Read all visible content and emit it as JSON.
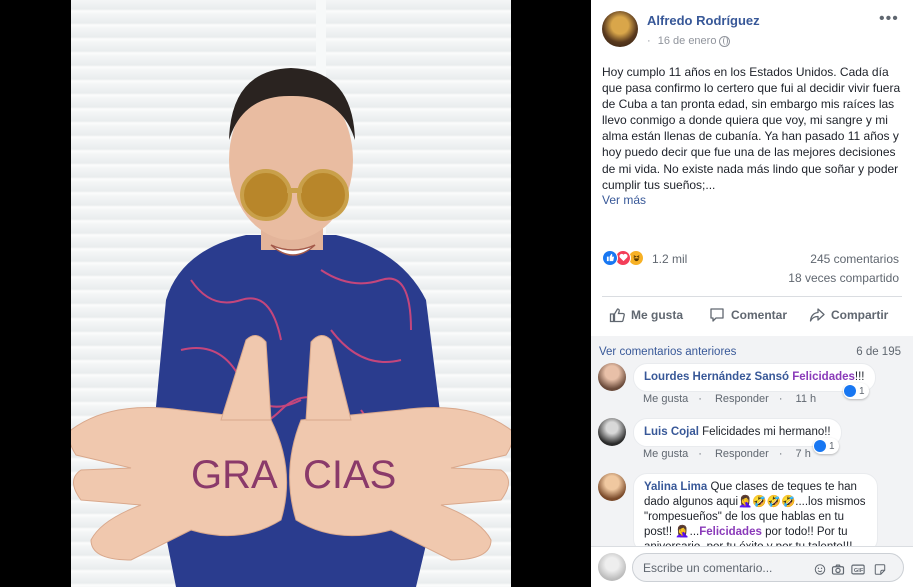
{
  "photo": {
    "alt": "",
    "hand_text_left": "GRA",
    "hand_text_right": "CIAS"
  },
  "post": {
    "author": "Alfredo Rodríguez",
    "date": "16 de enero",
    "separator": "·",
    "more_label": "•••",
    "text": "Hoy cumplo 11 años en los Estados Unidos. Cada día que pasa confirmo lo certero que fui al decidir vivir fuera de Cuba a tan pronta edad, sin embargo mis raíces las llevo conmigo a donde quiera que voy, mi sangre y mi alma están llenas de cubanía. Ya han pasado 11 años y hoy puedo decir que fue una de las mejores decisiones de mi vida. No existe nada más lindo que soñar y poder cumplir tus sueños;...",
    "see_more": "Ver más"
  },
  "stats": {
    "reactions": "1.2 mil",
    "comments": "245 comentarios",
    "shares": "18 veces compartido"
  },
  "actions": {
    "like": "Me gusta",
    "comment": "Comentar",
    "share": "Compartir"
  },
  "comments": {
    "previous_label": "Ver comentarios anteriores",
    "pager": "6 de 195",
    "items": [
      {
        "author": "Lourdes Hernández Sansó",
        "mention": "Felicidades",
        "text": "!!!",
        "like": "Me gusta",
        "reply": "Responder",
        "time": "11 h",
        "likes": "1"
      },
      {
        "author": "Luis Cojal",
        "text": "Felicidades mi hermano!!",
        "like": "Me gusta",
        "reply": "Responder",
        "time": "7 h",
        "likes": "1"
      },
      {
        "author": "Yalina Lima",
        "text_1": "Que clases de teques te han dado algunos aqui🤦‍♀️🤣🤣🤣....los mismos \"rompesueños\" de los que hablas en tu post!! 🤦‍♀️...",
        "mention": "Felicidades",
        "text_2": " por todo!! Por tu aniversario, por tu éxito y por tu talento!!!"
      }
    ]
  },
  "composer": {
    "placeholder": "Escribe un comentario..."
  },
  "colors": {
    "link_blue": "#385898",
    "like_blue": "#1877f2",
    "love_red": "#f33e58",
    "haha_yellow": "#f7b125",
    "mention_purple": "#8a3ab9"
  }
}
